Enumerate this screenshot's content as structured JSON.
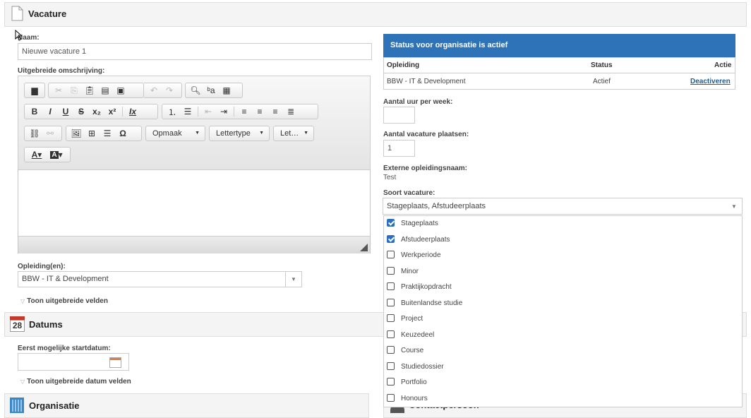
{
  "sections": {
    "vacature": "Vacature",
    "datums": "Datums",
    "datums_icon_text": "28",
    "organisatie": "Organisatie",
    "contactpersonen": "Contactpersoon"
  },
  "form": {
    "naam_label": "Naam:",
    "naam_value": "Nieuwe vacature 1",
    "omschrijving_label": "Uitgebreide omschrijving:",
    "opleidingen_label": "Opleiding(en):",
    "opleidingen_value": "BBW - IT & Development",
    "toon_velden": "Toon uitgebreide velden",
    "startdatum_label": "Eerst mogelijke startdatum:",
    "toon_datum_velden": "Toon uitgebreide datum velden"
  },
  "editor": {
    "combo_format": "Opmaak",
    "combo_font": "Lettertype",
    "combo_size": "Let…",
    "toolbar_row1": [
      "print-icon",
      "cut-icon",
      "copy-icon",
      "paste-icon",
      "paste-text-icon",
      "paste-word-icon",
      "undo-icon",
      "redo-icon",
      "find-icon",
      "replace-icon",
      "select-all-icon"
    ],
    "toolbar_row2": [
      "bold-icon",
      "italic-icon",
      "underline-icon",
      "strike-icon",
      "subscript-icon",
      "superscript-icon",
      "remove-format-icon",
      "numbered-list-icon",
      "bullet-list-icon",
      "outdent-icon",
      "indent-icon",
      "align-left-icon",
      "align-center-icon",
      "align-right-icon",
      "justify-icon"
    ],
    "toolbar_row3": [
      "link-icon",
      "unlink-icon",
      "image-icon",
      "table-icon",
      "horizontal-rule-icon",
      "special-char-icon"
    ]
  },
  "status_panel": {
    "header": "Status voor organisatie is actief",
    "columns": [
      "Opleiding",
      "Status",
      "Actie"
    ],
    "row": {
      "opleiding": "BBW - IT & Development",
      "status": "Actief",
      "actie": "Deactiveren"
    }
  },
  "right_form": {
    "uur_label": "Aantal uur per week:",
    "uur_value": "",
    "plaatsen_label": "Aantal vacature plaatsen:",
    "plaatsen_value": "1",
    "extern_label": "Externe opleidingsnaam:",
    "extern_value": "Test",
    "soort_label": "Soort vacature:",
    "soort_value": "Stageplaats, Afstudeerplaats"
  },
  "soort_options": [
    {
      "label": "Stageplaats",
      "checked": true
    },
    {
      "label": "Afstudeerplaats",
      "checked": true
    },
    {
      "label": "Werkperiode",
      "checked": false
    },
    {
      "label": "Minor",
      "checked": false
    },
    {
      "label": "Praktijkopdracht",
      "checked": false
    },
    {
      "label": "Buitenlandse studie",
      "checked": false
    },
    {
      "label": "Project",
      "checked": false
    },
    {
      "label": "Keuzedeel",
      "checked": false
    },
    {
      "label": "Course",
      "checked": false
    },
    {
      "label": "Studiedossier",
      "checked": false
    },
    {
      "label": "Portfolio",
      "checked": false
    },
    {
      "label": "Honours",
      "checked": false
    }
  ],
  "colors": {
    "accent": "#2e73b8",
    "link": "#1a5f99",
    "checkbox": "#2c6fbd"
  }
}
